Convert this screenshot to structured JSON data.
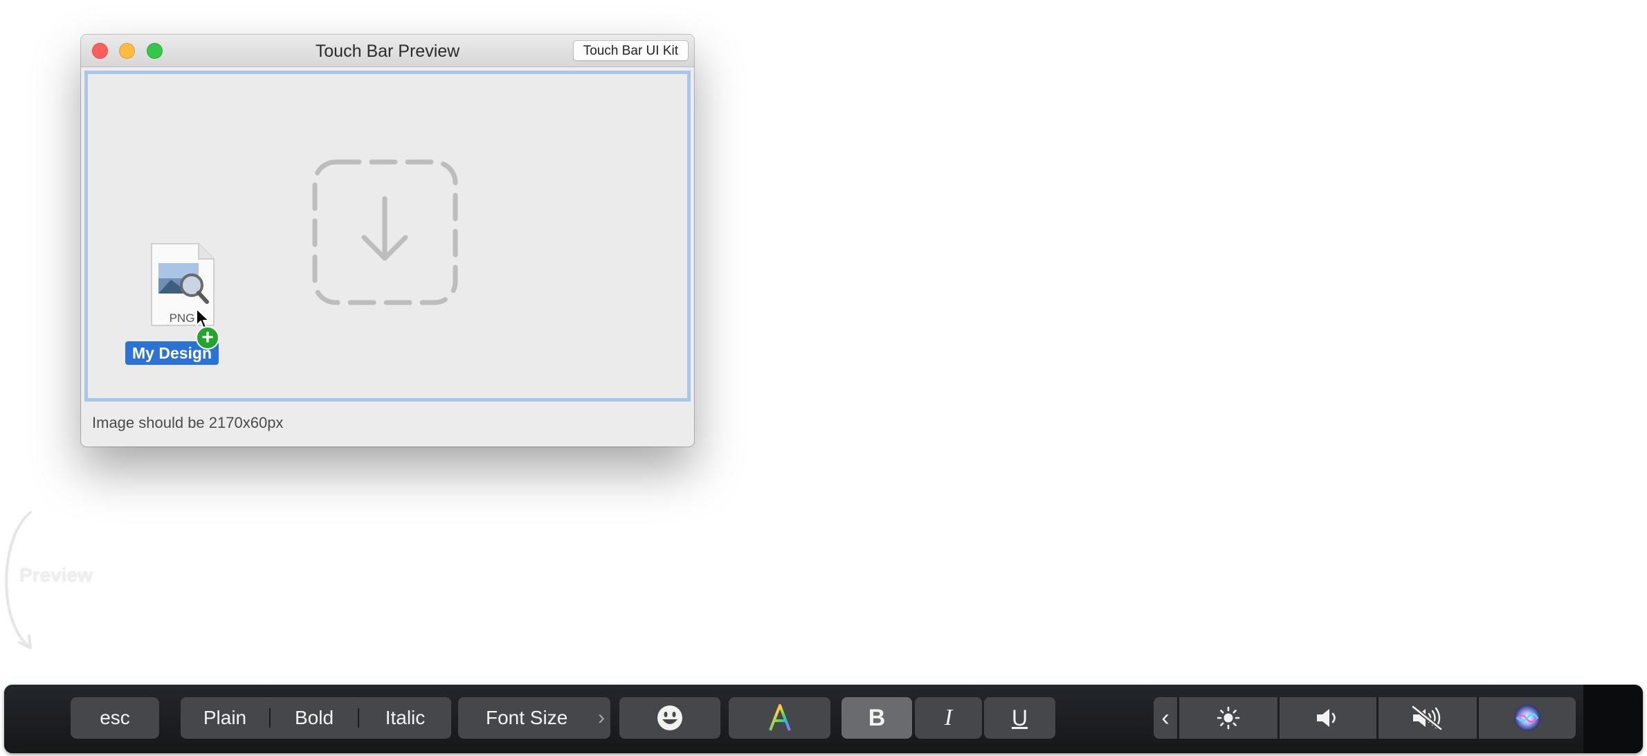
{
  "window": {
    "title": "Touch Bar Preview",
    "ui_kit_button": "Touch Bar UI Kit",
    "status_text": "Image should be 2170x60px"
  },
  "dropzone": {
    "icon": "download-arrow-icon",
    "dragged_file": {
      "name": "My Design",
      "extension": "PNG",
      "icon": "png-file-icon",
      "badge": "+"
    }
  },
  "annotation": {
    "label": "Preview"
  },
  "touchbar": {
    "esc": "esc",
    "style_segments": [
      "Plain",
      "Bold",
      "Italic"
    ],
    "font_size": "Font Size",
    "font_size_chevron": "›",
    "bold": "B",
    "italic": "I",
    "underline": "U",
    "expand_chevron": "‹",
    "icons": [
      "emoji-icon",
      "text-color-icon",
      "brightness-icon",
      "volume-icon",
      "mute-icon",
      "siri-icon"
    ]
  },
  "colors": {
    "selection_blue": "#2a73d4",
    "dropzone_border": "#aac6e6",
    "touchbar_key": "#46474b",
    "add_badge": "#22a52b"
  }
}
